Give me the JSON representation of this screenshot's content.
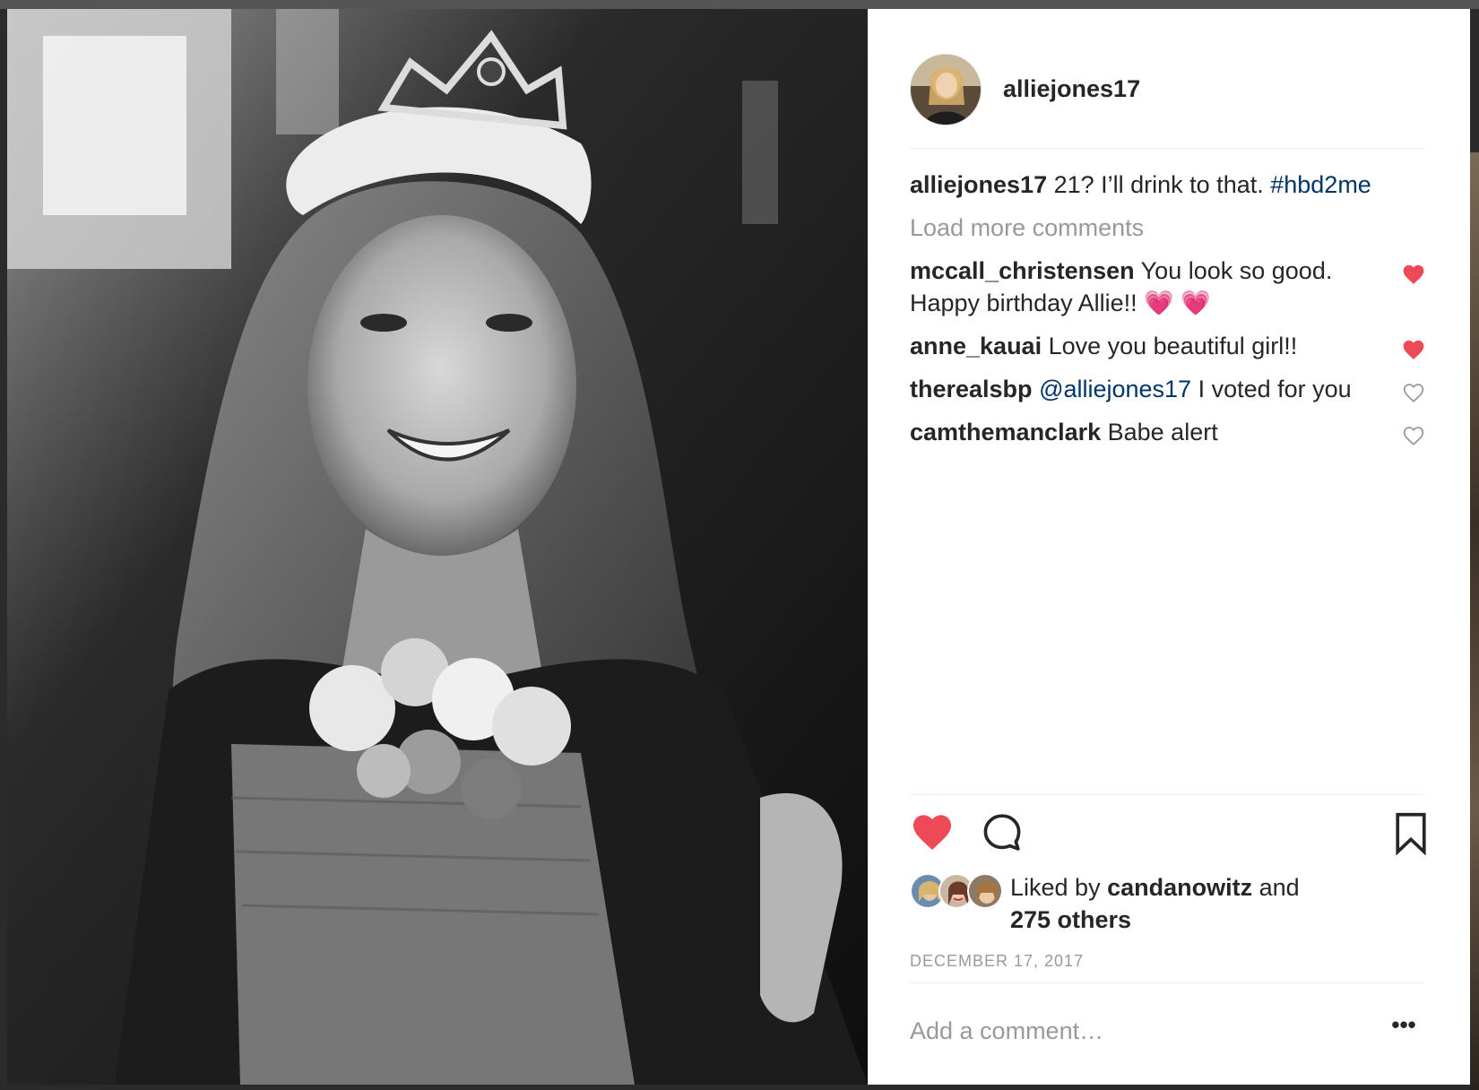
{
  "post": {
    "author": "alliejones17",
    "caption": {
      "username": "alliejones17",
      "text": " 21? I’ll drink to that. ",
      "hashtag": "#hbd2me"
    },
    "load_more_label": "Load more comments",
    "comments": [
      {
        "username": "mccall_christensen",
        "text": " You look so good. Happy birthday Allie!! ",
        "emoji": "💗 💗",
        "liked": true
      },
      {
        "username": "anne_kauai",
        "text": " Love you beautiful girl!!",
        "liked": true
      },
      {
        "username": "therealsbp",
        "mention": "@alliejones17",
        "text": " I voted for you",
        "liked": false
      },
      {
        "username": "camthemanclark",
        "text": " Babe alert",
        "liked": false
      }
    ],
    "likes": {
      "prefix": "Liked by ",
      "user": "candanowitz",
      "suffix": " and",
      "others": "275 others"
    },
    "date": "DECEMBER 17, 2017",
    "add_comment_placeholder": "Add a comment…",
    "more_label": "•••"
  },
  "icons": {
    "like": "heart-filled-icon",
    "comment": "speech-bubble-icon",
    "save": "bookmark-icon",
    "more": "ellipsis-icon"
  },
  "colors": {
    "like_red": "#ed4956",
    "link_blue": "#003569",
    "muted_gray": "#999999",
    "text": "#262626"
  }
}
